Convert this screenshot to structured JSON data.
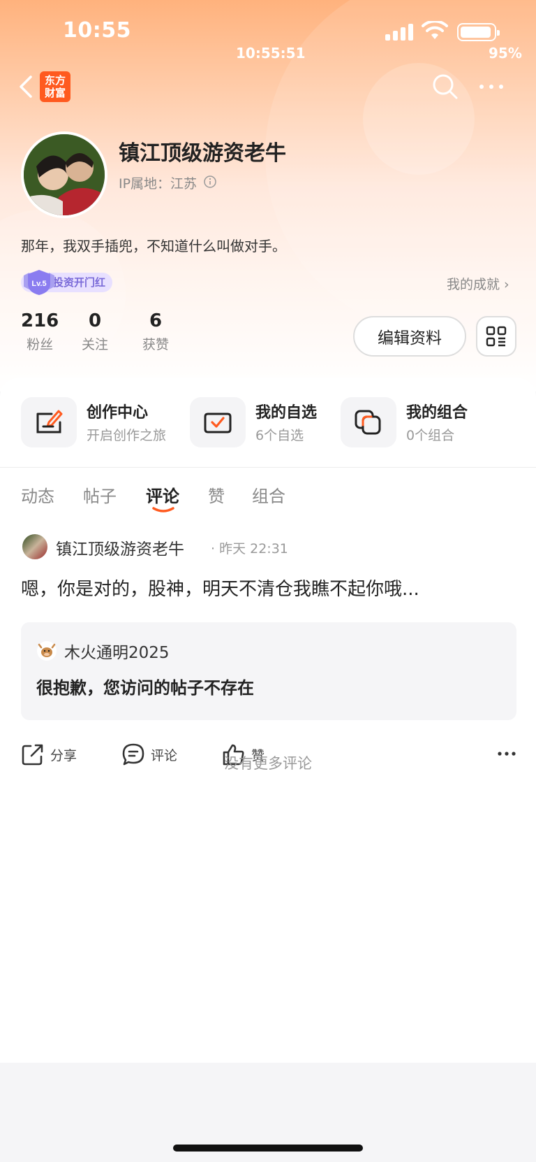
{
  "status_bar": {
    "time": "10:55",
    "clock_small": "10:55:51",
    "battery_pct": "95%"
  },
  "nav": {
    "logo_line1": "东方",
    "logo_line2": "财富"
  },
  "profile": {
    "username": "镇江顶级游资老牛",
    "ip_location": "IP属地：江苏",
    "bio": "那年，我双手插兜，不知道什么叫做对手。",
    "level": "Lv.5",
    "badge_text": "投资开门红",
    "achievement_link": "我的成就 ›",
    "stats": [
      {
        "num": "216",
        "label": "粉丝"
      },
      {
        "num": "0",
        "label": "关注"
      },
      {
        "num": "6",
        "label": "获赞"
      }
    ],
    "edit_button": "编辑资料"
  },
  "quick_links": [
    {
      "title": "创作中心",
      "sub": "开启创作之旅"
    },
    {
      "title": "我的自选",
      "sub": "6个自选"
    },
    {
      "title": "我的组合",
      "sub": "0个组合"
    }
  ],
  "tabs": [
    "动态",
    "帖子",
    "评论",
    "赞",
    "组合"
  ],
  "active_tab": "评论",
  "post": {
    "author": "镇江顶级游资老牛",
    "time": "· 昨天 22:31",
    "text": "嗯，你是对的，股神，明天不清仓我瞧不起你哦...",
    "quote_user": "木火通明2025",
    "quote_text": "很抱歉，您访问的帖子不存在",
    "actions": {
      "share": "分享",
      "comment": "评论",
      "like": "赞"
    }
  },
  "footer": {
    "no_more": "没有更多评论"
  },
  "colors": {
    "accent": "#ff5a1f",
    "header_top": "#ffb27d",
    "badge_bg": "#e8e0ff"
  }
}
